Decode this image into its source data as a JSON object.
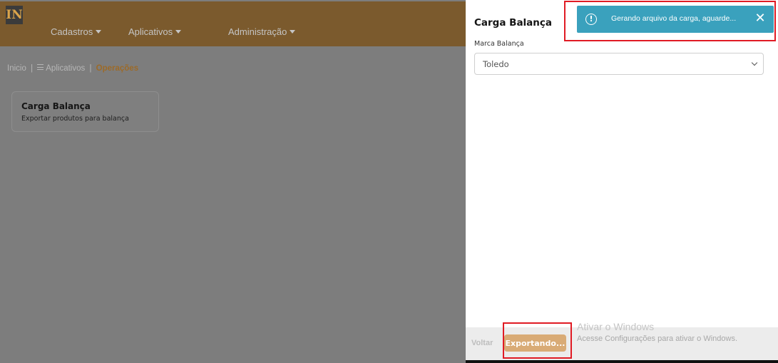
{
  "header": {
    "logo_text": "IN",
    "nav": [
      "Cadastros",
      "Aplicativos",
      "Administração"
    ]
  },
  "breadcrumb": {
    "items": [
      "Inicio",
      "Aplicativos"
    ],
    "current": "Operações",
    "separator": "|"
  },
  "card": {
    "title": "Carga Balança",
    "subtitle": "Exportar produtos para balança"
  },
  "panel": {
    "title": "Carga Balança",
    "field_label": "Marca Balança",
    "select_value": "Toledo",
    "back_label": "Voltar",
    "export_label": "Exportando..."
  },
  "toast": {
    "icon": "!",
    "message": "Gerando arquivo da carga, aguarde...",
    "close_glyph": "✕",
    "color": "#3aa1bd"
  },
  "watermark": {
    "title": "Ativar o Windows",
    "subtitle": "Acesse Configurações para ativar o Windows."
  },
  "colors": {
    "brand": "#7b5a2d",
    "accent": "#d9ab76",
    "highlight": "#e01b24"
  }
}
